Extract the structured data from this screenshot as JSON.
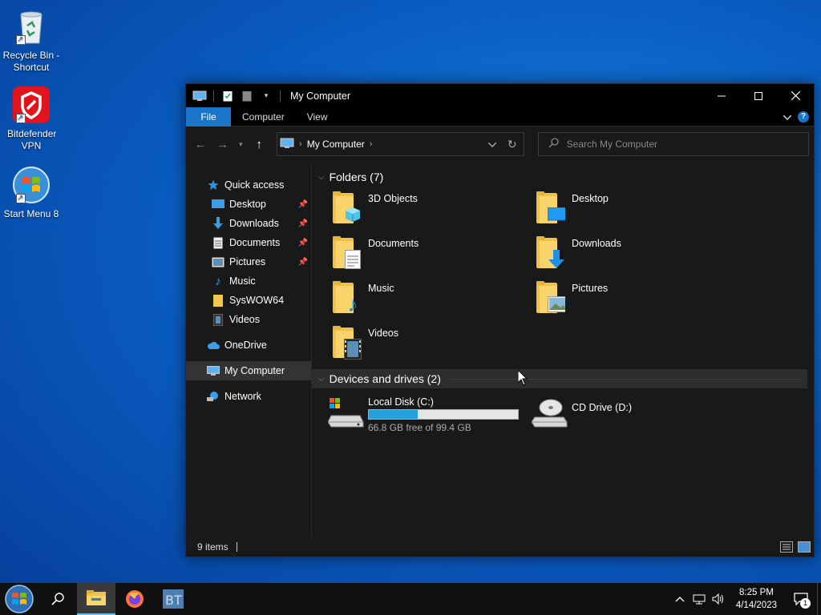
{
  "desktop": {
    "icons": [
      {
        "label": "Recycle Bin - Shortcut",
        "icon": "recycle-bin-icon"
      },
      {
        "label": "Bitdefender VPN",
        "icon": "bitdefender-icon"
      },
      {
        "label": "Start Menu 8",
        "icon": "start-menu-8-icon"
      }
    ]
  },
  "window": {
    "title": "My Computer",
    "ribbon": {
      "tabs": [
        "File",
        "Computer",
        "View"
      ]
    },
    "address": {
      "location": "My Computer"
    },
    "search": {
      "placeholder": "Search My Computer"
    },
    "sidebar": {
      "quick_access": "Quick access",
      "pinned": [
        "Desktop",
        "Downloads",
        "Documents",
        "Pictures"
      ],
      "other": [
        "Music",
        "SysWOW64",
        "Videos"
      ],
      "onedrive": "OneDrive",
      "my_computer": "My Computer",
      "network": "Network"
    },
    "groups": {
      "folders": "Folders (7)",
      "drives": "Devices and drives (2)"
    },
    "folders": [
      "3D Objects",
      "Desktop",
      "Documents",
      "Downloads",
      "Music",
      "Pictures",
      "Videos"
    ],
    "drives": {
      "c": {
        "name": "Local Disk (C:)",
        "free": "66.8 GB free of 99.4 GB",
        "used_fraction": 0.328
      },
      "d": {
        "name": "CD Drive (D:)"
      }
    },
    "status": {
      "items": "9 items"
    }
  },
  "taskbar": {
    "clock": {
      "time": "8:25 PM",
      "date": "4/14/2023"
    },
    "notification_count": "1",
    "pinned": [
      "file-explorer-icon",
      "firefox-icon",
      "bt-app-icon"
    ]
  },
  "colors": {
    "accent": "#1a74c7",
    "drive_fill": "#26a0da",
    "window_bg": "#191919"
  }
}
